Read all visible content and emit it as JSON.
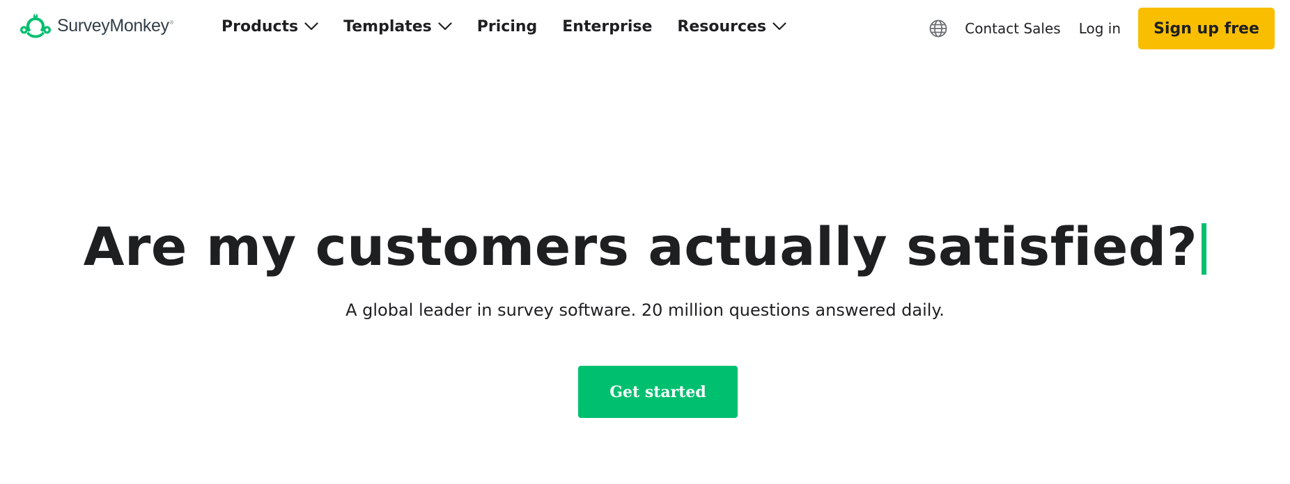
{
  "header": {
    "logo": {
      "text": "SurveyMonkey",
      "registered": "®",
      "icon": "surveymonkey-logo-icon",
      "color": "#00bf6f"
    },
    "nav": [
      {
        "label": "Products",
        "has_dropdown": true,
        "icon": "chevron-down-icon"
      },
      {
        "label": "Templates",
        "has_dropdown": true,
        "icon": "chevron-down-icon"
      },
      {
        "label": "Pricing",
        "has_dropdown": false
      },
      {
        "label": "Enterprise",
        "has_dropdown": false
      },
      {
        "label": "Resources",
        "has_dropdown": true,
        "icon": "chevron-down-icon"
      }
    ],
    "language_icon": "globe-icon",
    "contact_sales": "Contact Sales",
    "log_in": "Log in",
    "sign_up": "Sign up free"
  },
  "hero": {
    "headline": "Are my customers actually satisfied?",
    "subheadline": "A global leader in survey software. 20 million questions answered daily.",
    "cta": "Get started"
  },
  "colors": {
    "brand_green": "#00bf6f",
    "signup_yellow": "#f9be00",
    "text_dark": "#1e1f21",
    "background": "#ffffff"
  }
}
